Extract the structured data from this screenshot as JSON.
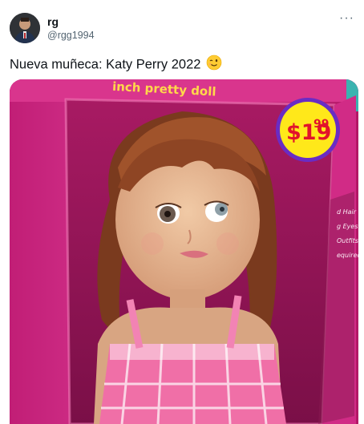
{
  "tweet": {
    "display_name": "rg",
    "handle": "@rgg1994",
    "text": "Nueva muñeca: Katy Perry 2022",
    "more_icon": "more-horizontal-icon",
    "emoji": "winking-face-icon"
  },
  "media": {
    "box_banner": "inch pretty doll",
    "price": "$1999",
    "price_dollars": "$19",
    "price_cents": "99",
    "side_panel_text": [
      "d Hair",
      "g Eyes",
      "Outfits",
      "equired"
    ],
    "colors": {
      "box_pink": "#d12b86",
      "price_tag_yellow": "#ffe81a",
      "price_tag_red": "#e2122b",
      "price_tag_border": "#6a2cc4"
    }
  }
}
